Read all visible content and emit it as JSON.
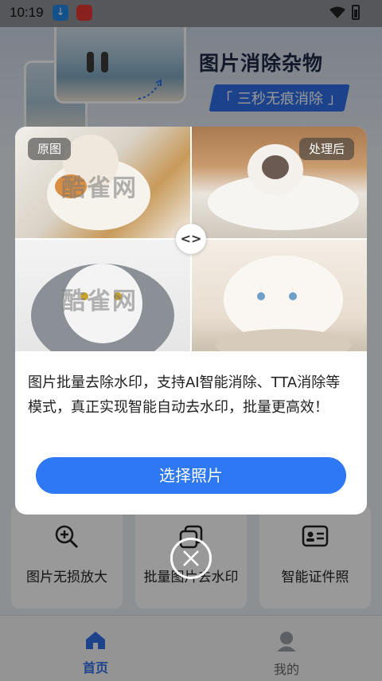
{
  "status_bar": {
    "time": "10:19"
  },
  "hero": {
    "title": "图片消除杂物",
    "tag": "「 三秒无痕消除 」"
  },
  "tools": [
    {
      "label": "图片无损放大",
      "icon": "zoom-in-icon"
    },
    {
      "label": "批量图片去水印",
      "icon": "copy-icon"
    },
    {
      "label": "智能证件照",
      "icon": "id-card-icon"
    }
  ],
  "bottom_nav": [
    {
      "label": "首页",
      "icon": "home-icon",
      "active": true
    },
    {
      "label": "我的",
      "icon": "user-icon",
      "active": false
    }
  ],
  "dialog": {
    "before_label": "原图",
    "after_label": "处理后",
    "watermark_text": "酷雀网",
    "split_handle": "<>",
    "description": "图片批量去除水印，支持AI智能消除、TTA消除等模式，真正实现智能自动去水印，批量更高效！",
    "button_label": "选择照片"
  },
  "colors": {
    "primary": "#2f78f5",
    "overlay": "rgba(0,0,0,0.40)"
  }
}
